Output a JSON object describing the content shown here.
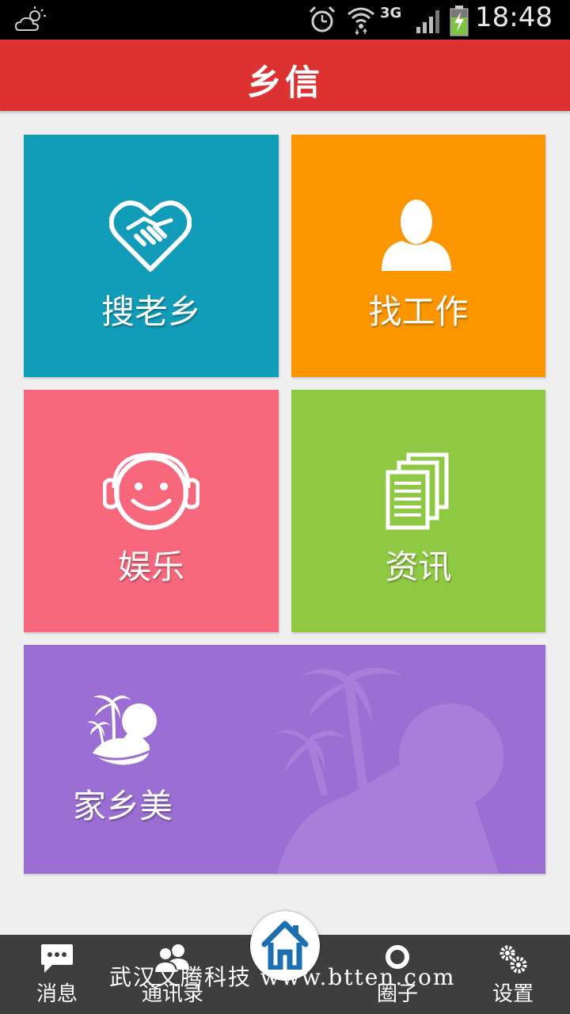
{
  "status_bar": {
    "time": "18:48",
    "network": "3G",
    "icons": [
      "weather-cloud-sun-icon",
      "alarm-icon",
      "wifi-icon",
      "signal-icon",
      "battery-charging-icon"
    ]
  },
  "header": {
    "title": "乡信"
  },
  "tiles": [
    {
      "label": "搜老乡",
      "icon": "handshake-heart-icon",
      "color": "#119cb8"
    },
    {
      "label": "找工作",
      "icon": "person-icon",
      "color": "#fb9600"
    },
    {
      "label": "娱乐",
      "icon": "smiley-headphones-icon",
      "color": "#f7687d"
    },
    {
      "label": "资讯",
      "icon": "documents-icon",
      "color": "#8fc843"
    },
    {
      "label": "家乡美",
      "icon": "palm-island-icon",
      "color": "#9b6ed3"
    }
  ],
  "bottom_nav": {
    "items": [
      {
        "label": "消息",
        "icon": "chat-bubble-icon"
      },
      {
        "label": "通讯录",
        "icon": "contacts-icon"
      },
      {
        "label": "",
        "icon": "home-icon"
      },
      {
        "label": "圈子",
        "icon": "circle-icon"
      },
      {
        "label": "设置",
        "icon": "gears-icon"
      }
    ]
  },
  "watermark": "武汉文腾科技 www.btten.com",
  "colors": {
    "header": "#dc3232",
    "background": "#efefef",
    "nav": "#3e3e3e"
  }
}
